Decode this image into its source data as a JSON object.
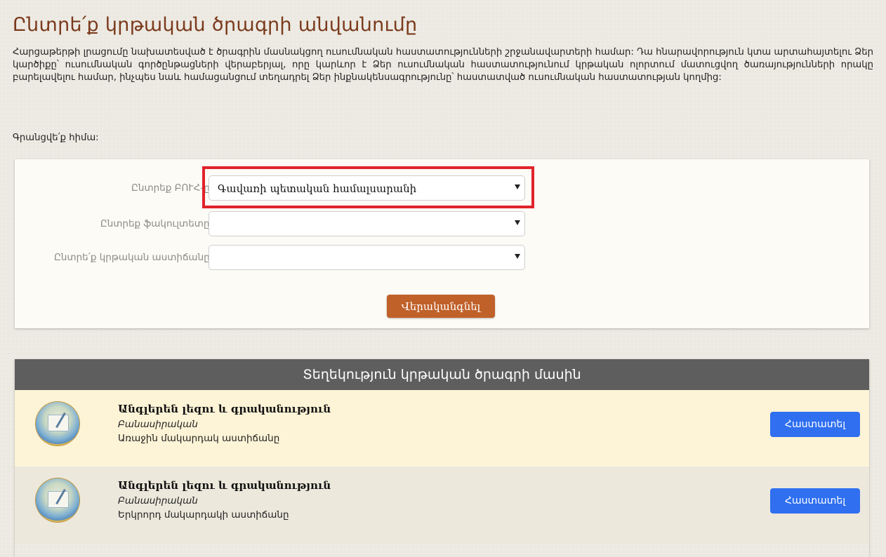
{
  "page": {
    "title": "Ընտրե՛ք կրթական ծրագրի անվանումը",
    "intro": "Հարցաթերթի լրացումը նախատեսված է ծրագրին մասնակցող ուսումնական հաստատությունների շրջանավարտերի համար: Դա հնարավորություն կտա արտահայտելու Ձեր կարծիքը՝ ուսումնական գործընթացների վերաբերյալ, որը կարևոր է Ձեր ուսումնական հաստատությունում կրթական ոլորտում մատուցվող ծառայությունների որակը բարելավելու համար, ինչպես նաև համացանցում տեղադրել Ձեր ինքնակենսագրությունը՝ հաստատված ուսումնական հաստատության կողմից:",
    "register_text": "Գրանցվե՛ք հիմա:"
  },
  "filters": {
    "university_label": "Ընտրեք ԲՈՒՀ-ը.",
    "university_value": "Գավառի պետական համալսարանի",
    "faculty_label": "Ընտրեք ֆակուլտետը:",
    "faculty_value": "",
    "degree_label": "Ընտրե՛ք կրթական աստիճանը.",
    "degree_value": "",
    "search_button": "Վերականգնել"
  },
  "results": {
    "header": "Տեղեկություն կրթական ծրագրի մասին",
    "items": [
      {
        "title": "Անգլերեն լեզու և գրականություն",
        "faculty": "Բանասիրական",
        "degree": "Առաջին մակարդակ աստիճանը",
        "button": "Հաստատել"
      },
      {
        "title": "Անգլերեն լեզու և գրականություն",
        "faculty": "Բանասիրական",
        "degree": "Երկրորդ մակարդակի աստիճանը",
        "button": "Հաստատել"
      }
    ]
  },
  "colors": {
    "title": "#7a3a1c",
    "search_button": "#c0612a",
    "confirm_button": "#2f6ff0",
    "header_bg": "#5e5e5e",
    "highlight": "#e0232a"
  }
}
